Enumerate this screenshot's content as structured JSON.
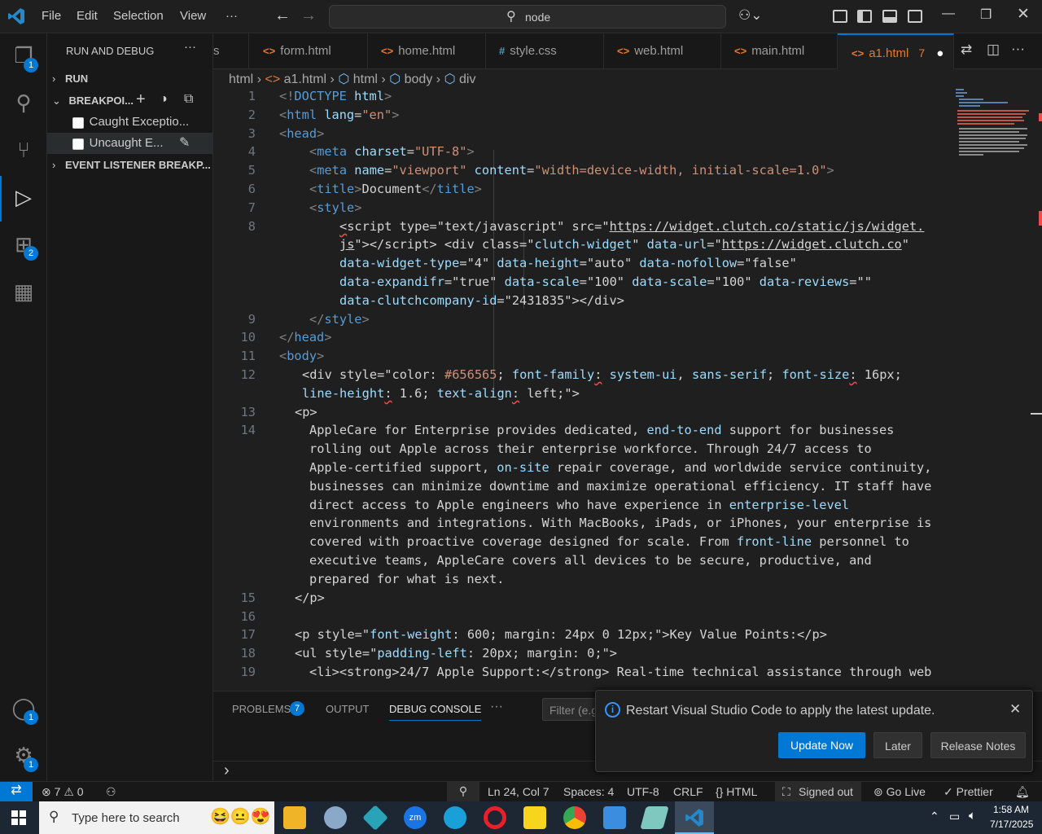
{
  "titlebar": {
    "menus": [
      "File",
      "Edit",
      "Selection",
      "View",
      "···"
    ],
    "search_text": "node"
  },
  "activity": {
    "explorer_badge": "1",
    "extensions_badge": "2",
    "accounts_badge": "1",
    "manage_badge": "1"
  },
  "sidebar": {
    "title": "RUN AND DEBUG",
    "more": "···",
    "run": "RUN",
    "breakpoints": "BREAKPOI...",
    "caught": "Caught Exceptio...",
    "uncaught": "Uncaught E...",
    "event_listener": "EVENT LISTENER BREAKP..."
  },
  "tabs": [
    {
      "label": "s",
      "icon": ""
    },
    {
      "label": "form.html",
      "icon": "<>"
    },
    {
      "label": "home.html",
      "icon": "<>"
    },
    {
      "label": "style.css",
      "icon": "#"
    },
    {
      "label": "web.html",
      "icon": "<>"
    },
    {
      "label": "main.html",
      "icon": "<>"
    },
    {
      "label": "a1.html",
      "icon": "<>",
      "problems": "7",
      "modified": "●"
    }
  ],
  "breadcrumb": [
    "html",
    "a1.html",
    "html",
    "body",
    "div"
  ],
  "editor": {
    "line_numbers": [
      "1",
      "2",
      "3",
      "4",
      "5",
      "6",
      "7",
      "8",
      "",
      "",
      "",
      "",
      "9",
      "10",
      "11",
      "12",
      "",
      "13",
      "14",
      "",
      "",
      "",
      "",
      "",
      "",
      "",
      "",
      "15",
      "16",
      "17",
      "18",
      "19"
    ]
  },
  "panel": {
    "tabs": [
      "PROBLEMS",
      "OUTPUT",
      "DEBUG CONSOLE",
      "···"
    ],
    "problems_count": "7",
    "filter_placeholder": "Filter (e.g.",
    "prompt": "›"
  },
  "notification": {
    "message": "Restart Visual Studio Code to apply the latest update.",
    "update_now": "Update Now",
    "later": "Later",
    "release_notes": "Release Notes"
  },
  "status": {
    "errors": "7",
    "warnings": "0",
    "position": "Ln 24, Col 7",
    "spaces": "Spaces: 4",
    "encoding": "UTF-8",
    "eol": "CRLF",
    "language": "HTML",
    "account": "Signed out",
    "golive": "Go Live",
    "prettier": "Prettier"
  },
  "taskbar": {
    "search_placeholder": "Type here to search",
    "time": "1:58 AM",
    "date": "7/17/2025"
  },
  "colors": {
    "accent": "#0078d4",
    "tag": "#569cd6",
    "attr": "#9cdcfe",
    "string": "#ce9178",
    "html_icon": "#e37933"
  }
}
